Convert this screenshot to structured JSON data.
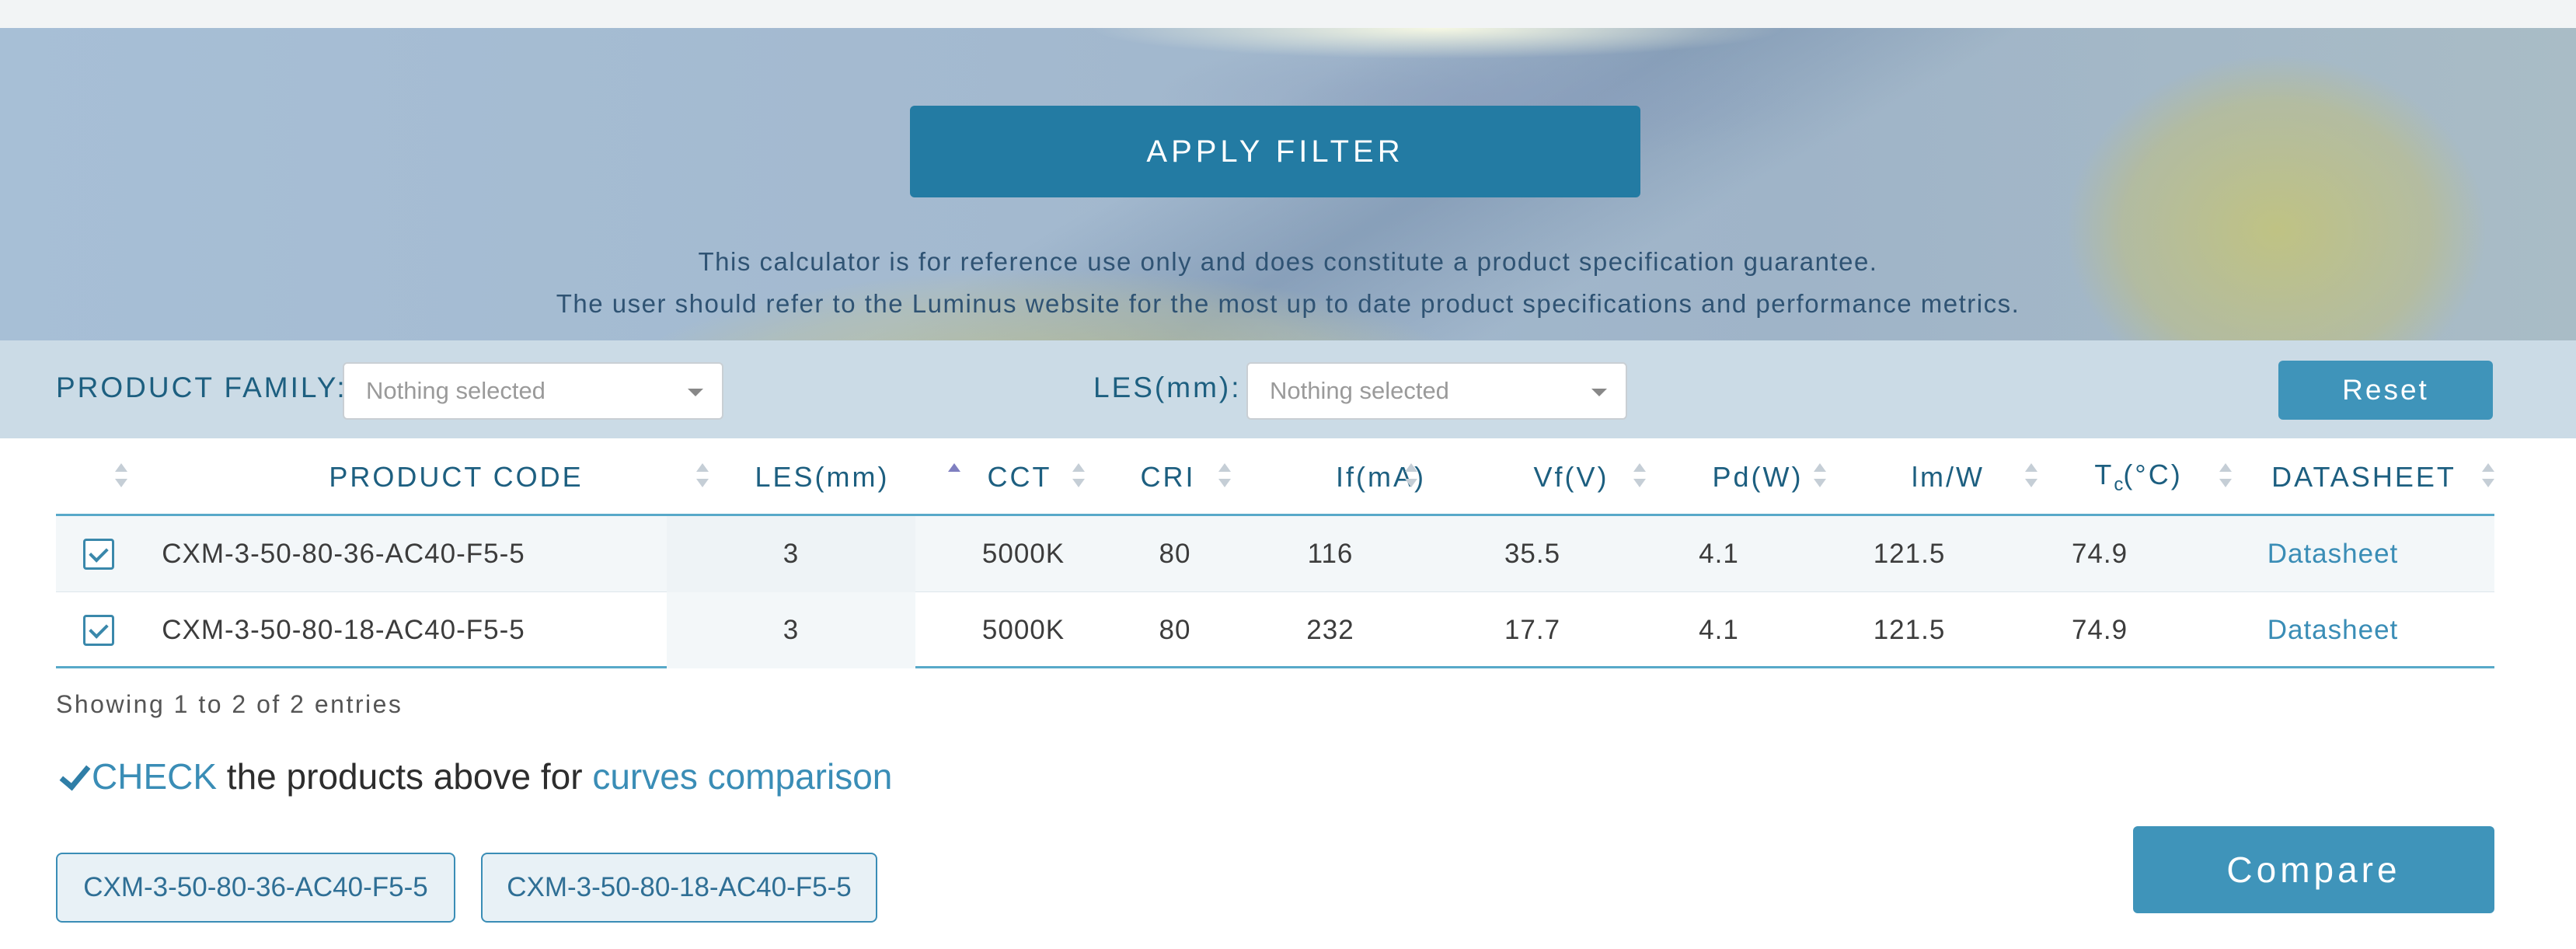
{
  "banner": {
    "apply_filter_label": "APPLY FILTER",
    "disclaimer_line1": "This calculator is for reference use only and does constitute a product specification guarantee.",
    "disclaimer_line2": "The user should refer to the Luminus website for the most up to date product specifications and performance metrics."
  },
  "filters": {
    "product_family_label": "PRODUCT FAMILY:",
    "product_family_value": "Nothing selected",
    "les_label": "LES(mm):",
    "les_value": "Nothing selected",
    "reset_label": "Reset"
  },
  "table": {
    "columns": {
      "product_code": "PRODUCT CODE",
      "les": "LES(mm)",
      "cct": "CCT",
      "cri": "CRI",
      "if": "If(mA)",
      "vf": "Vf(V)",
      "pd": "Pd(W)",
      "lmw": "lm/W",
      "tc_main": "T",
      "tc_sub": "c",
      "tc_tail": "(°C)",
      "datasheet": "DATASHEET"
    },
    "sorted_column": "les",
    "rows": [
      {
        "checked": true,
        "product_code": "CXM-3-50-80-36-AC40-F5-5",
        "les": "3",
        "cct": "5000K",
        "cri": "80",
        "if": "116",
        "vf": "35.5",
        "pd": "4.1",
        "lmw": "121.5",
        "tc": "74.9",
        "datasheet": "Datasheet"
      },
      {
        "checked": true,
        "product_code": "CXM-3-50-80-18-AC40-F5-5",
        "les": "3",
        "cct": "5000K",
        "cri": "80",
        "if": "232",
        "vf": "17.7",
        "pd": "4.1",
        "lmw": "121.5",
        "tc": "74.9",
        "datasheet": "Datasheet"
      }
    ]
  },
  "showing_text": "Showing 1 to 2 of 2 entries",
  "compare_section": {
    "check_word": "CHECK",
    "middle_text": " the products above for ",
    "link_text": "curves comparison",
    "selected_tags": [
      "CXM-3-50-80-36-AC40-F5-5",
      "CXM-3-50-80-18-AC40-F5-5"
    ],
    "compare_label": "Compare"
  },
  "colors": {
    "accent": "#237ba3",
    "button": "#3f94ba",
    "link": "#3a8db6"
  }
}
